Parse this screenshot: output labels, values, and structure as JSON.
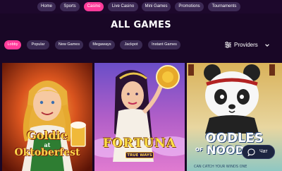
{
  "nav": {
    "items": [
      {
        "label": "Home",
        "active": false
      },
      {
        "label": "Sports",
        "active": false
      },
      {
        "label": "Casino",
        "active": true
      },
      {
        "label": "Live Casino",
        "active": false
      },
      {
        "label": "Mini Games",
        "active": false
      },
      {
        "label": "Promotions",
        "active": false
      },
      {
        "label": "Tournaments",
        "active": false
      }
    ]
  },
  "page": {
    "title": "ALL GAMES"
  },
  "filters": {
    "items": [
      {
        "label": "Lobby",
        "active": true
      },
      {
        "label": "Popular",
        "active": false
      },
      {
        "label": "New Games",
        "active": false
      },
      {
        "label": "Megaways",
        "active": false
      },
      {
        "label": "Jackpot",
        "active": false
      },
      {
        "label": "Instant Games",
        "active": false
      }
    ],
    "providers_label": "Providers",
    "providers_icon": "sliders-icon",
    "providers_chevron_icon": "chevron-down-icon"
  },
  "games": [
    {
      "title_line1": "Goldie",
      "title_line2": "at",
      "title_line3": "Oktoberfest"
    },
    {
      "title": "FORTUNA",
      "badge": "TRUE WAYS"
    },
    {
      "title": "OODLES",
      "title_prefix": "OF",
      "title_suffix": "NOOD",
      "tagline": "CAN CATCH YOUR WINDS ONE"
    }
  ],
  "chat": {
    "label": "Чат",
    "icon": "chat-bubble-icon"
  },
  "colors": {
    "background": "#190726",
    "accent": "#ff3b9a",
    "pill": "#3d2a55"
  }
}
